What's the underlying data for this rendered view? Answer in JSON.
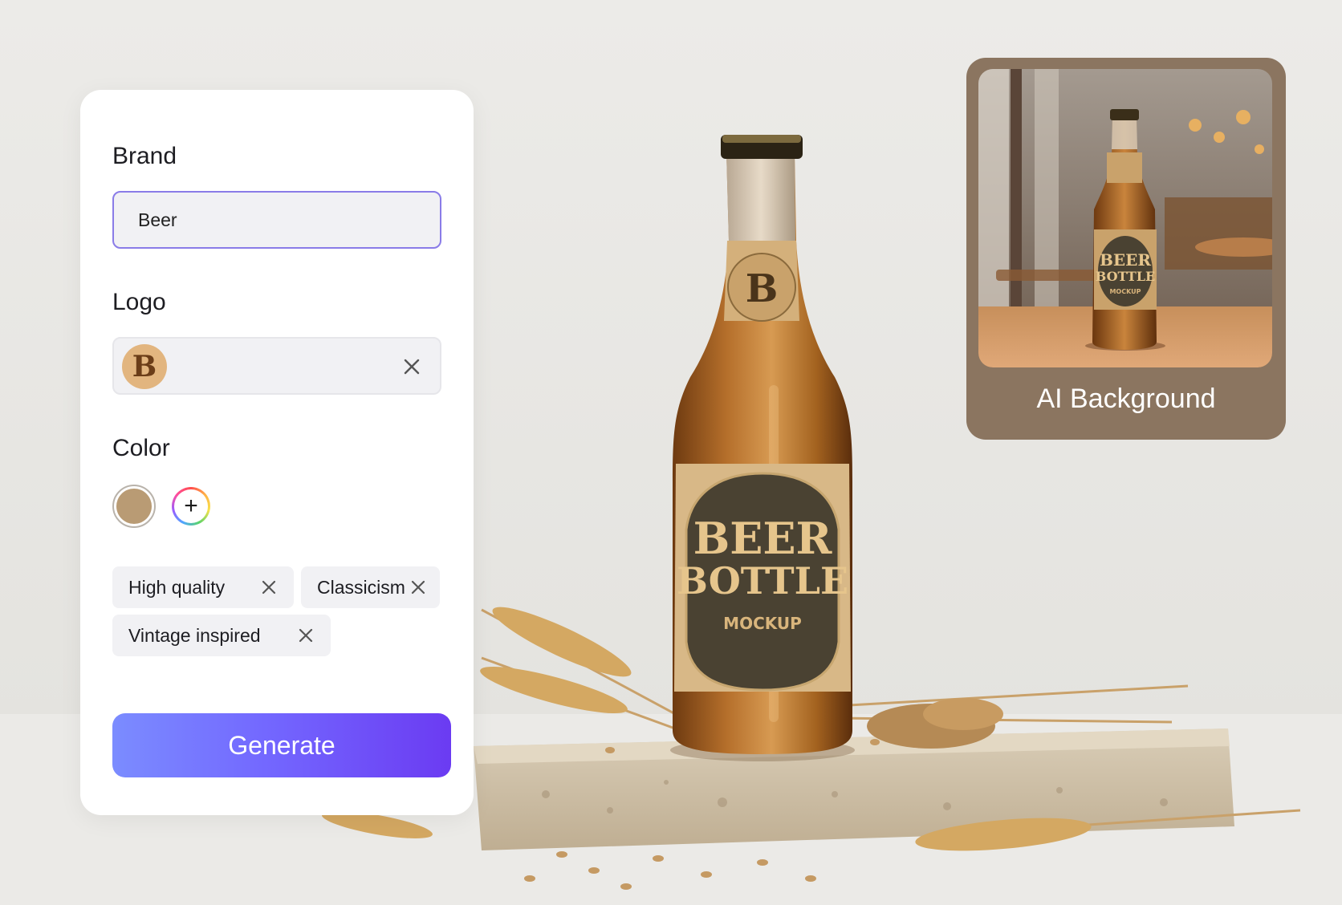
{
  "form": {
    "brand": {
      "label": "Brand",
      "value": "Beer"
    },
    "logo": {
      "label": "Logo",
      "monogram": "B"
    },
    "color": {
      "label": "Color",
      "selected": "#b99b74"
    },
    "tags": [
      {
        "label": "High quality"
      },
      {
        "label": "Classicism"
      },
      {
        "label": "Vintage inspired"
      }
    ],
    "generate_label": "Generate"
  },
  "preview": {
    "caption": "AI Background",
    "label": {
      "line1": "BEER",
      "line2": "BOTTLE",
      "line3": "MOCKUP"
    }
  },
  "product": {
    "label": {
      "line1": "BEER",
      "line2": "BOTTLE",
      "line3": "MOCKUP",
      "monogram": "B"
    }
  },
  "colors": {
    "accent_border": "#8a7ce8",
    "generate_gradient_start": "#7b8cff",
    "generate_gradient_end": "#6b3bf2",
    "preview_card": "#8b7560",
    "swatch": "#b99b74"
  }
}
